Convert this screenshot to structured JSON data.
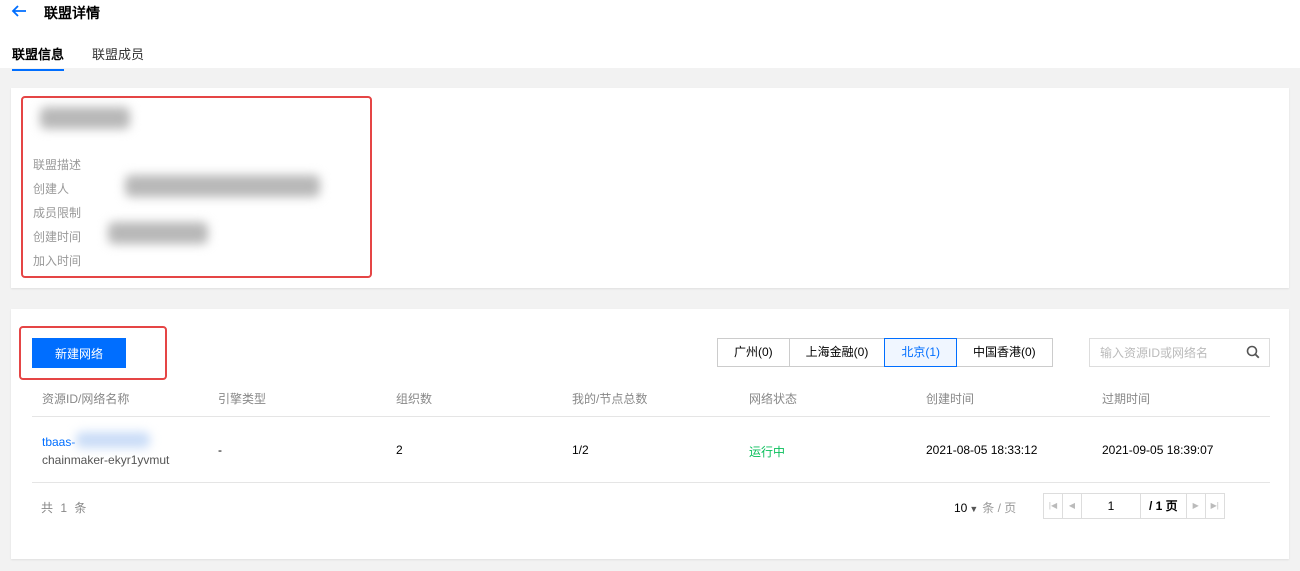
{
  "header": {
    "title": "联盟详情"
  },
  "tabs": [
    {
      "label": "联盟信息",
      "active": true
    },
    {
      "label": "联盟成员",
      "active": false
    }
  ],
  "info": {
    "labels": [
      "联盟描述",
      "创建人",
      "成员限制",
      "创建时间",
      "加入时间"
    ]
  },
  "toolbar": {
    "new_button": "新建网络",
    "regions": [
      {
        "label": "广州(0)",
        "active": false
      },
      {
        "label": "上海金融(0)",
        "active": false
      },
      {
        "label": "北京(1)",
        "active": true
      },
      {
        "label": "中国香港(0)",
        "active": false
      }
    ],
    "search_placeholder": "输入资源ID或网络名"
  },
  "table": {
    "columns": [
      "资源ID/网络名称",
      "引擎类型",
      "组织数",
      "我的/节点总数",
      "网络状态",
      "创建时间",
      "过期时间"
    ],
    "rows": [
      {
        "resource_id": "tbaas-",
        "network_name": "chainmaker-ekyr1yvmut",
        "engine": "-",
        "orgs": "2",
        "nodes": "1/2",
        "status": "运行中",
        "created": "2021-08-05 18:33:12",
        "expires": "2021-09-05 18:39:07"
      }
    ]
  },
  "pagination": {
    "total": "共 1 条",
    "page_size": "10",
    "page_size_unit": "条 / 页",
    "current_page": "1",
    "total_pages": "/ 1 页"
  },
  "colors": {
    "accent": "#006eff",
    "running": "#0abf5b",
    "highlight": "#e54545"
  }
}
